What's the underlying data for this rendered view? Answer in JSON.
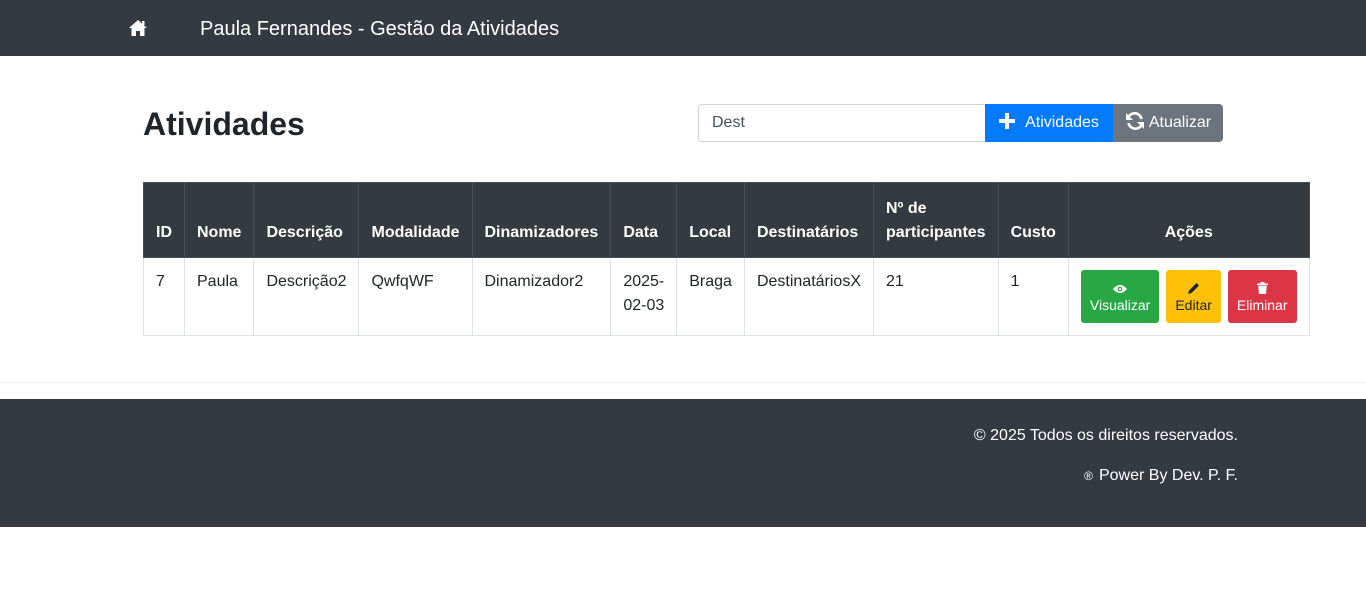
{
  "navbar": {
    "home_icon": "home-icon",
    "brand": "Paula Fernandes - Gestão da Atividades"
  },
  "page": {
    "title": "Atividades"
  },
  "search": {
    "value": "Dest",
    "placeholder": ""
  },
  "toolbar": {
    "add_label": "Atividades",
    "add_icon": "plus-icon",
    "refresh_label": "Atualizar",
    "refresh_icon": "refresh-icon"
  },
  "table": {
    "headers": {
      "id": "ID",
      "nome": "Nome",
      "descricao": "Descrição",
      "modalidade": "Modalidade",
      "dinamizadores": "Dinamizadores",
      "data": "Data",
      "local": "Local",
      "destinatarios": "Destinatários",
      "participantes_1": "Nº de",
      "participantes_2": "participantes",
      "custo": "Custo",
      "acoes": "Ações"
    },
    "rows": [
      {
        "id": "7",
        "nome": "Paula",
        "descricao": "Descrição2",
        "modalidade": "QwfqWF",
        "dinamizadores": "Dinamizador2",
        "data_1": "2025-",
        "data_2": "02-03",
        "local": "Braga",
        "destinatarios": "DestinatáriosX",
        "participantes": "21",
        "custo": "1"
      }
    ],
    "actions": {
      "view": "Visualizar",
      "edit": "Editar",
      "delete": "Eliminar"
    }
  },
  "footer": {
    "copyright": "© 2025 Todos os direitos reservados.",
    "power_symbol": "®",
    "power": "Power By Dev. P. F."
  },
  "colors": {
    "navbar": "#343a40",
    "primary": "#007bff",
    "secondary": "#6c757d",
    "success": "#28a745",
    "warning": "#ffc107",
    "danger": "#dc3545"
  }
}
